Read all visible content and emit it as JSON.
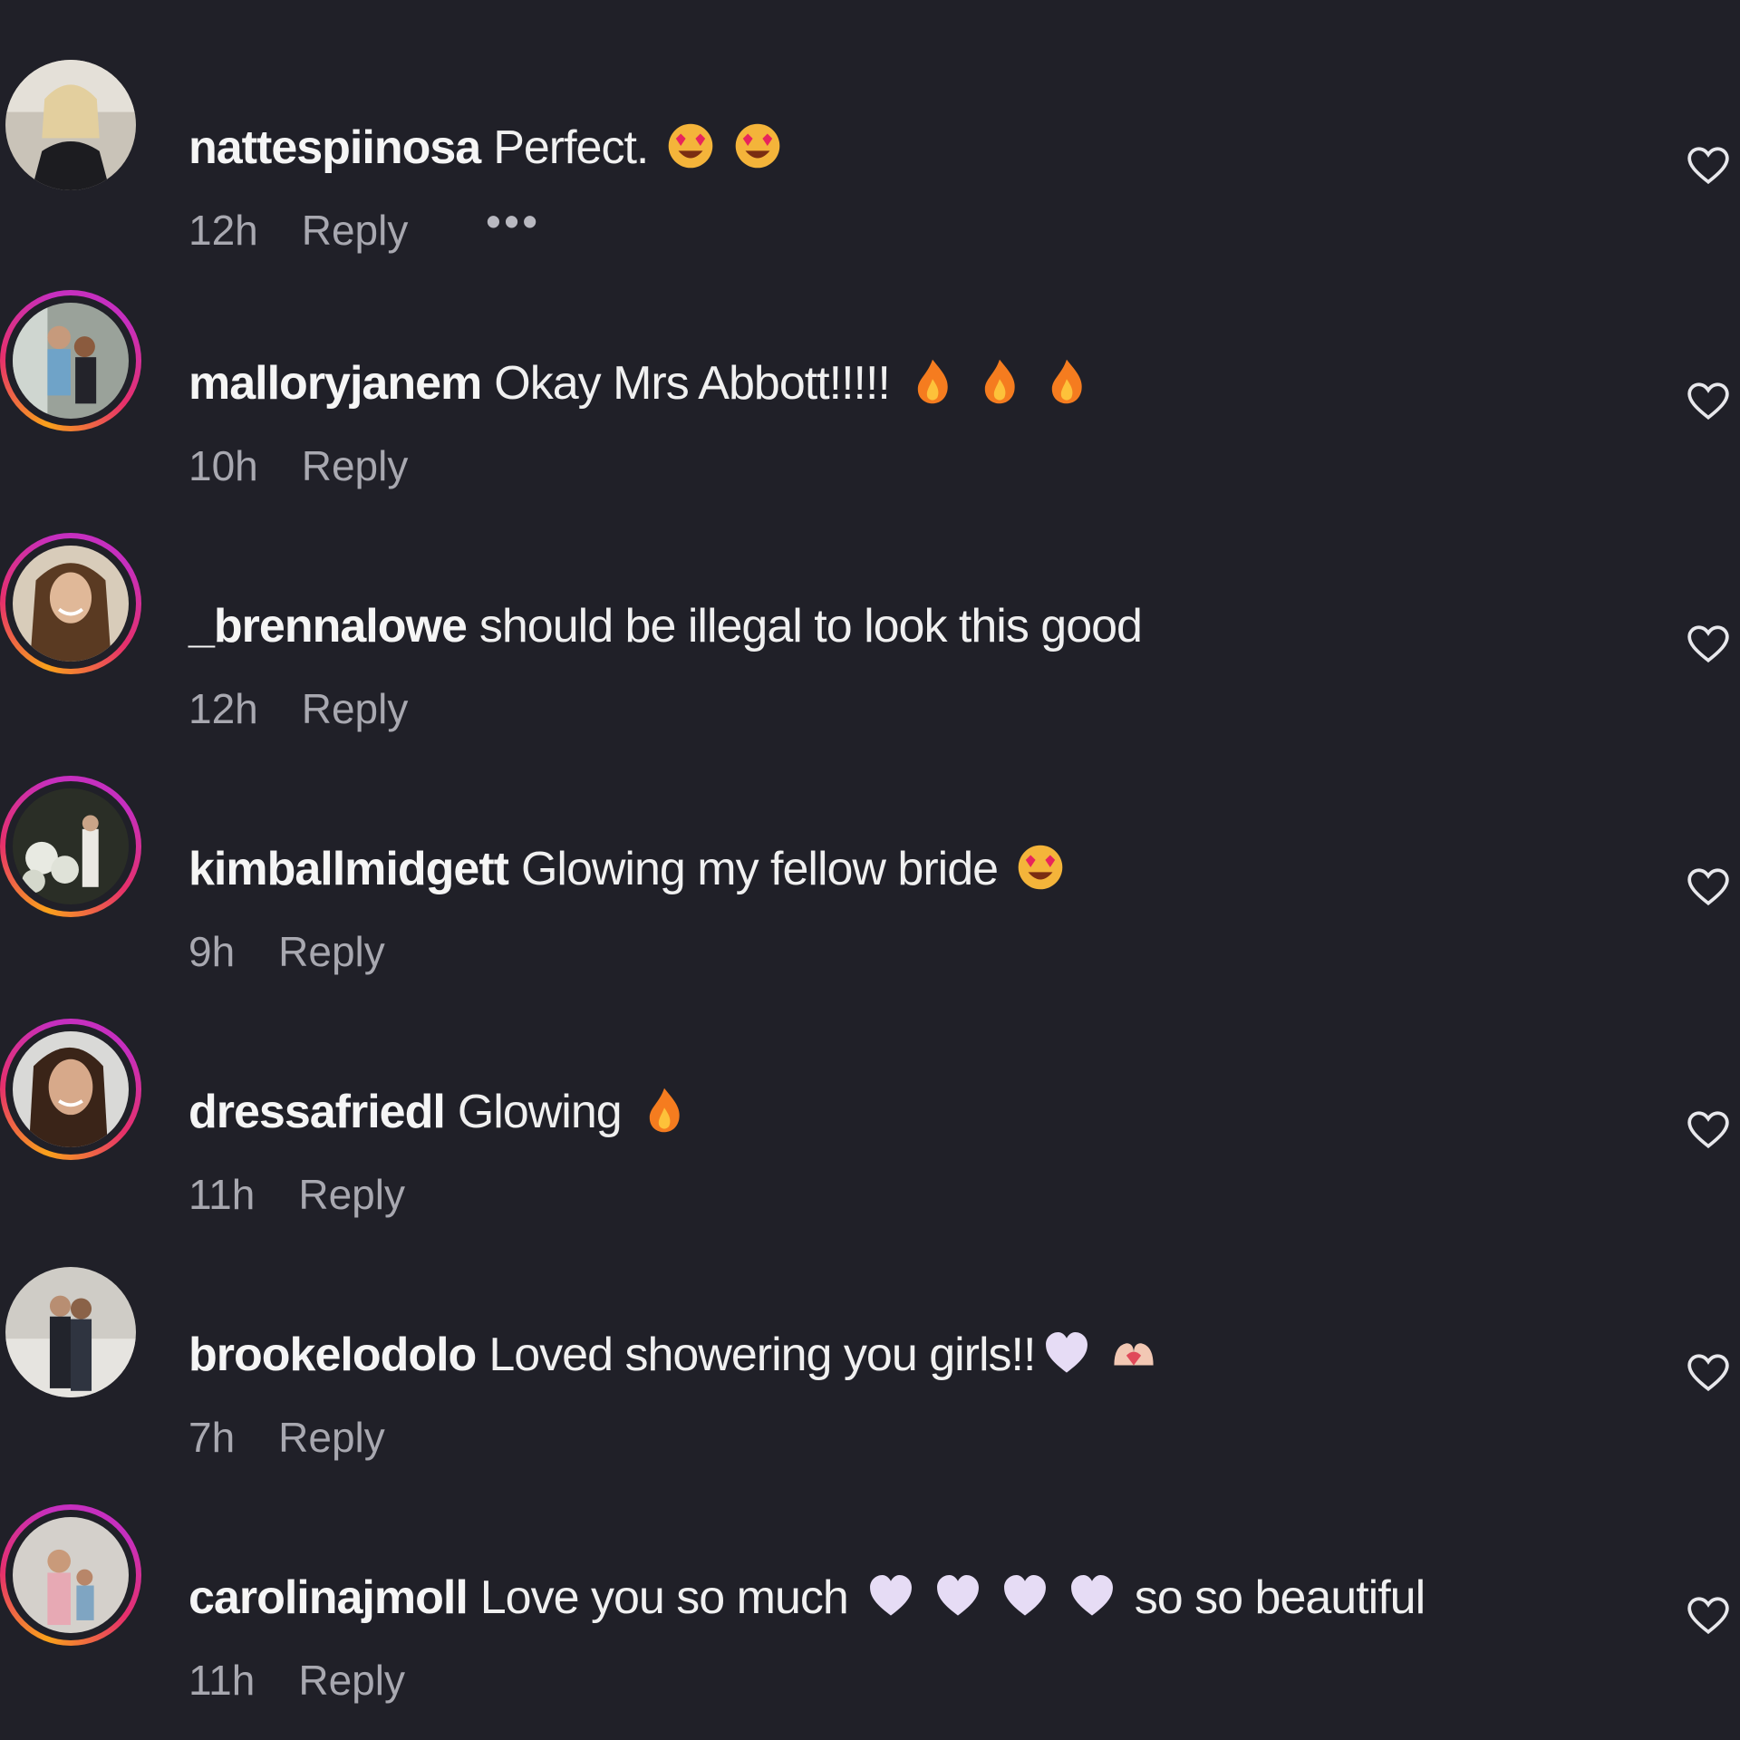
{
  "comments": [
    {
      "username": "nattespiinosa",
      "text": "Perfect.",
      "emojis": [
        "star-struck-emoji",
        "star-struck-emoji"
      ],
      "text_after": "",
      "time": "12h",
      "reply_label": "Reply",
      "more_label": "•••",
      "avatar_ring": false
    },
    {
      "username": "malloryjanem",
      "text": "Okay Mrs Abbott!!!!!",
      "emojis": [
        "fire-emoji",
        "fire-emoji",
        "fire-emoji"
      ],
      "text_after": "",
      "time": "10h",
      "reply_label": "Reply",
      "avatar_ring": true
    },
    {
      "username": "_brennalowe",
      "text": "should be illegal to look this good",
      "emojis": [],
      "text_after": "",
      "time": "12h",
      "reply_label": "Reply",
      "avatar_ring": true
    },
    {
      "username": "kimballmidgett",
      "text": "Glowing my fellow bride",
      "emojis": [
        "star-struck-emoji"
      ],
      "text_after": "",
      "time": "9h",
      "reply_label": "Reply",
      "avatar_ring": true
    },
    {
      "username": "dressafriedl",
      "text": "Glowing",
      "emojis": [
        "fire-emoji"
      ],
      "text_after": "",
      "time": "11h",
      "reply_label": "Reply",
      "avatar_ring": true
    },
    {
      "username": "brookelodolo",
      "text": "Loved showering you girls!!",
      "emojis": [
        "white-heart-emoji",
        "heart-hands-emoji"
      ],
      "text_after": "",
      "time": "7h",
      "reply_label": "Reply",
      "avatar_ring": false
    },
    {
      "username": "carolinajmoll",
      "text": "Love you so much",
      "emojis": [
        "white-heart-emoji",
        "white-heart-emoji",
        "white-heart-emoji",
        "white-heart-emoji"
      ],
      "text_after": "so so beautiful",
      "time": "11h",
      "reply_label": "Reply",
      "avatar_ring": true
    }
  ],
  "colors": {
    "background": "#202028",
    "text": "#f0f0f0",
    "meta_text": "#a8a8b0",
    "story_ring_start": "#f9a11b",
    "story_ring_end": "#c62fbf"
  }
}
